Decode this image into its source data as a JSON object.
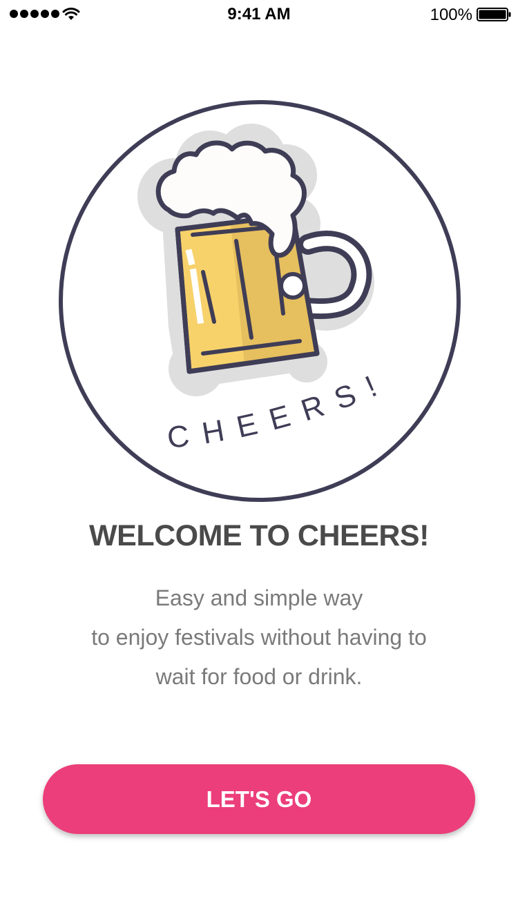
{
  "status_bar": {
    "time": "9:41 AM",
    "battery_percent": "100%"
  },
  "hero": {
    "badge_text": "CHEERS!",
    "icon": "beer-mug-icon"
  },
  "welcome": {
    "title": "WELCOME TO CHEERS!",
    "subtitle_lines": [
      "Easy and simple way",
      "to enjoy festivals without having to",
      "wait for food or drink."
    ]
  },
  "cta": {
    "label": "LET'S GO"
  },
  "colors": {
    "accent": "#ec3e7a",
    "outline": "#3f3d56",
    "beer": "#f7d26b",
    "beer_shade": "#e6bf5e",
    "title": "#4a4a4a",
    "subtitle": "#7a7a7a"
  }
}
